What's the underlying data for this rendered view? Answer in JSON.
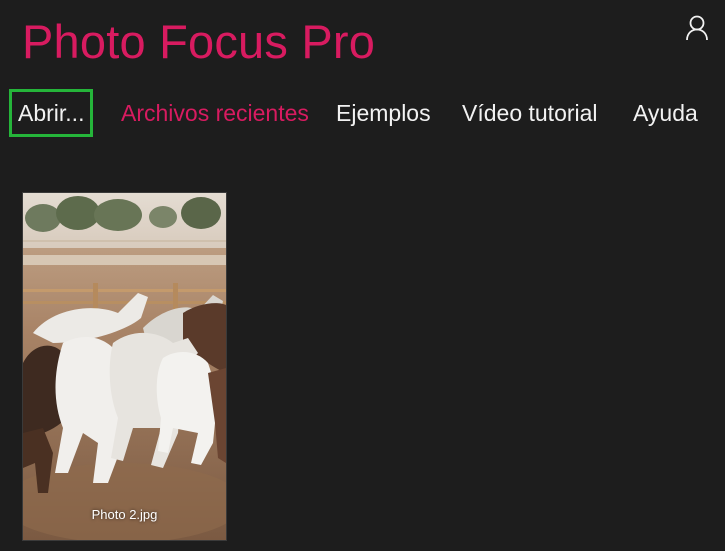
{
  "app": {
    "title": "Photo Focus Pro",
    "accent_color": "#d81b60",
    "focus_color": "#25b53a",
    "user_icon": "user-icon"
  },
  "nav": {
    "items": [
      {
        "label": "Abrir...",
        "state": "focused"
      },
      {
        "label": "Archivos recientes",
        "state": "selected"
      },
      {
        "label": "Ejemplos",
        "state": "normal"
      },
      {
        "label": "Vídeo tutorial",
        "state": "normal"
      },
      {
        "label": "Ayuda",
        "state": "normal"
      }
    ]
  },
  "recent_files": [
    {
      "name": "Photo 2.jpg",
      "thumbnail": "running-horses-photo"
    }
  ]
}
